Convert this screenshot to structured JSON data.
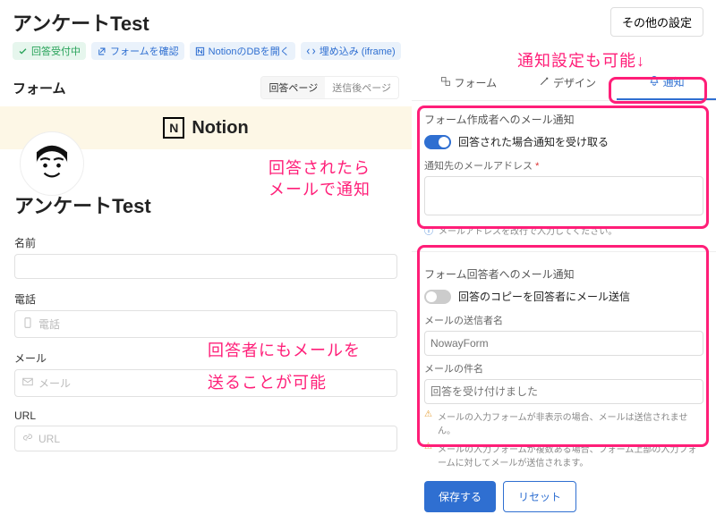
{
  "header": {
    "title": "アンケートTest",
    "other_settings": "その他の設定"
  },
  "tags": {
    "accepting": "回答受付中",
    "check_form": "フォームを確認",
    "open_db": "NotionのDBを開く",
    "embed": "埋め込み (iframe)"
  },
  "left": {
    "heading": "フォーム",
    "tabs": {
      "answer": "回答ページ",
      "after": "送信後ページ"
    },
    "logo_text": "Notion",
    "form_title": "アンケートTest",
    "fields": {
      "name": {
        "label": "名前"
      },
      "phone": {
        "label": "電話",
        "placeholder": "電話"
      },
      "mail": {
        "label": "メール",
        "placeholder": "メール"
      },
      "url": {
        "label": "URL",
        "placeholder": "URL"
      }
    }
  },
  "right": {
    "tabs": {
      "form": "フォーム",
      "design": "デザイン",
      "notify": "通知"
    },
    "creator": {
      "title": "フォーム作成者へのメール通知",
      "toggle_label": "回答された場合通知を受け取る",
      "address_label": "通知先のメールアドレス",
      "info": "メールアドレスを改行で入力してください。"
    },
    "respondent": {
      "title": "フォーム回答者へのメール通知",
      "toggle_label": "回答のコピーを回答者にメール送信",
      "sender_label": "メールの送信者名",
      "sender_placeholder": "NowayForm",
      "subject_label": "メールの件名",
      "subject_placeholder": "回答を受け付けました",
      "warn1": "メールの入力フォームが非表示の場合、メールは送信されません。",
      "warn2": "メールの入力フォームが複数ある場合、フォーム上部の入力フォームに対してメールが送信されます。"
    },
    "buttons": {
      "save": "保存する",
      "reset": "リセット"
    }
  },
  "annotations": {
    "top": "通知設定も可能↓",
    "mid1": "回答されたら",
    "mid2": "メールで通知",
    "bot1": "回答者にもメールを",
    "bot2": "送ることが可能"
  }
}
